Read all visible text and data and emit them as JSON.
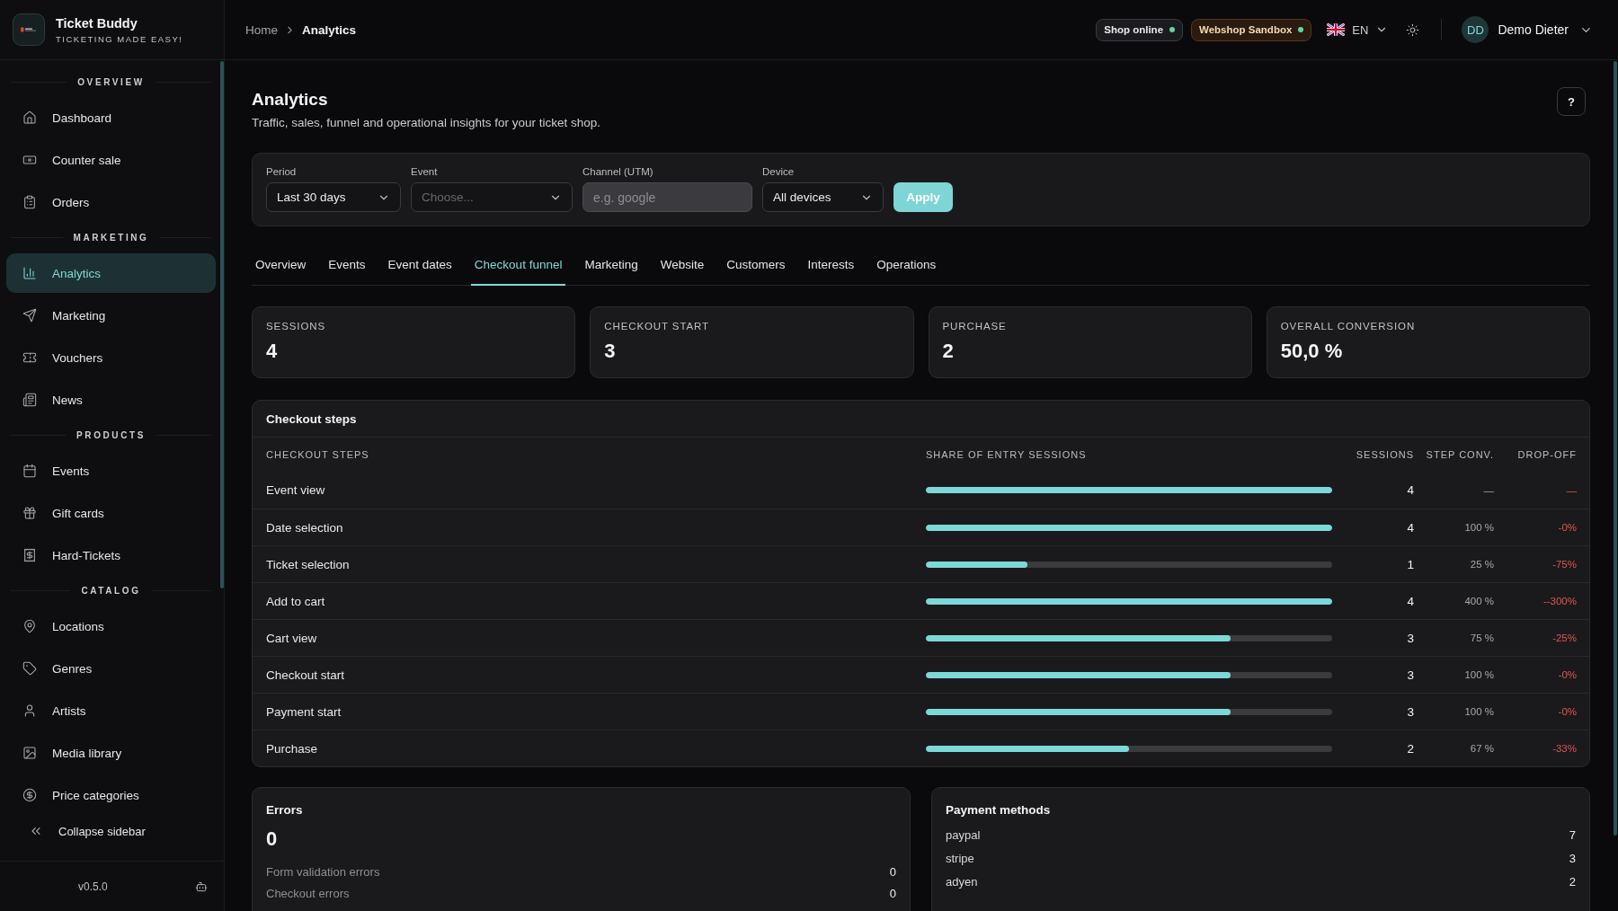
{
  "sidebar": {
    "brand": {
      "name": "Ticket Buddy",
      "tagline": "TICKETING MADE EASY!"
    },
    "sections": [
      {
        "title": "OVERVIEW",
        "items": [
          {
            "label": "Dashboard",
            "selected": false
          },
          {
            "label": "Counter sale",
            "selected": false
          },
          {
            "label": "Orders",
            "selected": false
          }
        ]
      },
      {
        "title": "MARKETING",
        "items": [
          {
            "label": "Analytics",
            "selected": true
          },
          {
            "label": "Marketing",
            "selected": false
          },
          {
            "label": "Vouchers",
            "selected": false
          },
          {
            "label": "News",
            "selected": false
          }
        ]
      },
      {
        "title": "PRODUCTS",
        "items": [
          {
            "label": "Events",
            "selected": false
          },
          {
            "label": "Gift cards",
            "selected": false
          },
          {
            "label": "Hard-Tickets",
            "selected": false
          }
        ]
      },
      {
        "title": "CATALOG",
        "items": [
          {
            "label": "Locations",
            "selected": false
          },
          {
            "label": "Genres",
            "selected": false
          },
          {
            "label": "Artists",
            "selected": false
          },
          {
            "label": "Media library",
            "selected": false
          },
          {
            "label": "Price categories",
            "selected": false
          }
        ]
      }
    ],
    "collapse": "Collapse sidebar",
    "version": "v0.5.0"
  },
  "topbar": {
    "breadcrumb": [
      {
        "label": "Home",
        "current": false
      },
      {
        "label": "Analytics",
        "current": true
      }
    ],
    "badges": [
      {
        "label": "Shop online",
        "kind": "neutral"
      },
      {
        "label": "Webshop Sandbox",
        "kind": "sandbox"
      }
    ],
    "language": "EN",
    "user": {
      "initials": "DD",
      "name": "Demo Dieter"
    }
  },
  "page": {
    "title": "Analytics",
    "subtitle": "Traffic, sales, funnel and operational insights for your ticket shop.",
    "help": "?"
  },
  "filters": {
    "fields": [
      {
        "label": "Period",
        "kind": "select",
        "value": "Last 30 days"
      },
      {
        "label": "Event",
        "kind": "select",
        "placeholder": "Choose..."
      },
      {
        "label": "Channel (UTM)",
        "kind": "input",
        "placeholder": "e.g. google"
      },
      {
        "label": "Device",
        "kind": "select",
        "value": "All devices"
      }
    ],
    "apply": "Apply"
  },
  "tabs": [
    {
      "label": "Overview",
      "selected": false
    },
    {
      "label": "Events",
      "selected": false
    },
    {
      "label": "Event dates",
      "selected": false
    },
    {
      "label": "Checkout funnel",
      "selected": true
    },
    {
      "label": "Marketing",
      "selected": false
    },
    {
      "label": "Website",
      "selected": false
    },
    {
      "label": "Customers",
      "selected": false
    },
    {
      "label": "Interests",
      "selected": false
    },
    {
      "label": "Operations",
      "selected": false
    }
  ],
  "stats": [
    {
      "label": "SESSIONS",
      "value": "4"
    },
    {
      "label": "CHECKOUT START",
      "value": "3"
    },
    {
      "label": "PURCHASE",
      "value": "2"
    },
    {
      "label": "OVERALL CONVERSION",
      "value": "50,0 %"
    }
  ],
  "funnel": {
    "title": "Checkout steps",
    "columns": [
      "CHECKOUT STEPS",
      "SHARE OF ENTRY SESSIONS",
      "SESSIONS",
      "STEP CONV.",
      "DROP-OFF"
    ],
    "rows": [
      {
        "step": "Event view",
        "level": 1,
        "sessions": "4",
        "step_conv": "—",
        "drop_off": "—"
      },
      {
        "step": "Date selection",
        "level": 1,
        "sessions": "4",
        "step_conv": "100 %",
        "drop_off": "-0%"
      },
      {
        "step": "Ticket selection",
        "level": 0.25,
        "sessions": "1",
        "step_conv": "25 %",
        "drop_off": "-75%"
      },
      {
        "step": "Add to cart",
        "level": 1,
        "sessions": "4",
        "step_conv": "400 %",
        "drop_off": "--300%"
      },
      {
        "step": "Cart view",
        "level": 0.75,
        "sessions": "3",
        "step_conv": "75 %",
        "drop_off": "-25%"
      },
      {
        "step": "Checkout start",
        "level": 0.75,
        "sessions": "3",
        "step_conv": "100 %",
        "drop_off": "-0%"
      },
      {
        "step": "Payment start",
        "level": 0.75,
        "sessions": "3",
        "step_conv": "100 %",
        "drop_off": "-0%"
      },
      {
        "step": "Purchase",
        "level": 0.5,
        "sessions": "2",
        "step_conv": "67 %",
        "drop_off": "-33%"
      }
    ]
  },
  "errors": {
    "title": "Errors",
    "total": "0",
    "rows": [
      {
        "label": "Form validation errors",
        "value": "0"
      },
      {
        "label": "Checkout errors",
        "value": "0"
      }
    ]
  },
  "payment_methods": {
    "title": "Payment methods",
    "rows": [
      {
        "label": "paypal",
        "value": "7"
      },
      {
        "label": "stripe",
        "value": "3"
      },
      {
        "label": "adyen",
        "value": "2"
      }
    ]
  }
}
